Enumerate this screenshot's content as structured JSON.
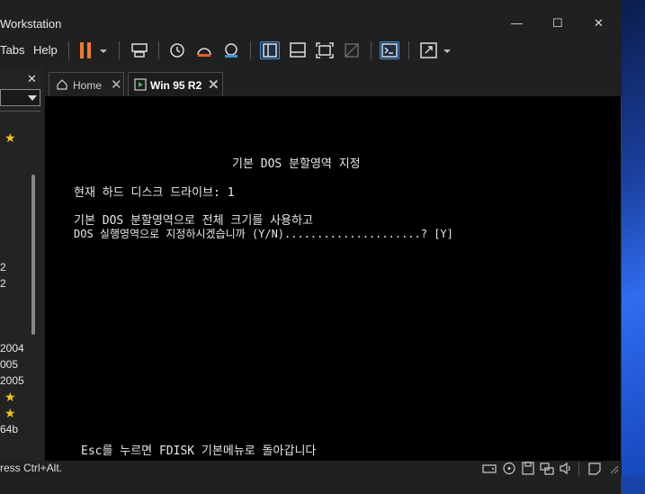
{
  "window": {
    "title": "Workstation"
  },
  "menu": {
    "tabs_label": "Tabs",
    "help_label": "Help"
  },
  "sidebar": {
    "items": [
      "2",
      "2",
      "2004",
      "005",
      "2005",
      "64b"
    ]
  },
  "tabs": [
    {
      "label": "Home",
      "active": false
    },
    {
      "label": "Win 95 R2",
      "active": true
    }
  ],
  "vm_screen": {
    "title": "기본 DOS 분할영역 지정",
    "current_drive": "현재 하드 디스크 드라이브: 1",
    "question_line1": "기본 DOS 분할영역으로 전체 크기를 사용하고",
    "question_line2": "DOS 실행영역으로 지정하시겠습니까 (Y/N).....................? [Y]",
    "footer": "Esc를 누르면 FDISK 기본메뉴로 돌아갑니다"
  },
  "status": {
    "hint": "ress Ctrl+Alt."
  },
  "colors": {
    "accent_pause": "#f07a2a",
    "star": "#f2c318"
  }
}
